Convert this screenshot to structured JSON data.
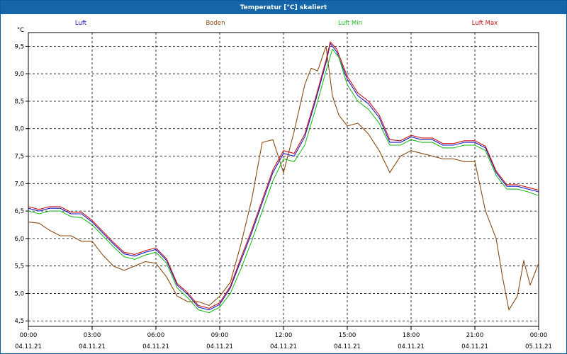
{
  "window": {
    "title": "Temperatur [°C] skaliert"
  },
  "chart_data": {
    "type": "line",
    "title": "Temperatur [°C] skaliert",
    "ylabel": "°C",
    "xlabel": "",
    "ylim": [
      4.4,
      9.75
    ],
    "xlim": [
      0,
      24
    ],
    "grid": true,
    "legend_position": "top",
    "y_ticks": [
      "9,5",
      "9,0",
      "8,5",
      "8,0",
      "7,5",
      "7,0",
      "6,5",
      "6,0",
      "5,5",
      "5,0",
      "4,5"
    ],
    "y_tick_values": [
      9.5,
      9.0,
      8.5,
      8.0,
      7.5,
      7.0,
      6.5,
      6.0,
      5.5,
      5.0,
      4.5
    ],
    "x_ticks": [
      {
        "time": "00:00",
        "date": "04.11.21",
        "value": 0
      },
      {
        "time": "03:00",
        "date": "04.11.21",
        "value": 3
      },
      {
        "time": "06:00",
        "date": "04.11.21",
        "value": 6
      },
      {
        "time": "09:00",
        "date": "04.11.21",
        "value": 9
      },
      {
        "time": "12:00",
        "date": "04.11.21",
        "value": 12
      },
      {
        "time": "15:00",
        "date": "04.11.21",
        "value": 15
      },
      {
        "time": "18:00",
        "date": "04.11.21",
        "value": 18
      },
      {
        "time": "21:00",
        "date": "04.11.21",
        "value": 21
      },
      {
        "time": "00:00",
        "date": "05.11.21",
        "value": 24
      }
    ],
    "series": [
      {
        "name": "Luft",
        "color": "#1a1acc",
        "x": [
          0,
          0.5,
          1,
          1.5,
          2,
          2.5,
          3,
          3.5,
          4,
          4.5,
          5,
          5.5,
          6,
          6.5,
          7,
          7.5,
          8,
          8.5,
          9,
          9.5,
          10,
          10.5,
          11,
          11.5,
          12,
          12.5,
          13,
          13.5,
          14,
          14.2,
          14.5,
          15,
          15.5,
          16,
          16.5,
          17,
          17.5,
          18,
          18.5,
          19,
          19.5,
          20,
          20.5,
          21,
          21.5,
          22,
          22.5,
          23,
          23.5,
          24
        ],
        "y": [
          6.55,
          6.5,
          6.55,
          6.55,
          6.45,
          6.45,
          6.3,
          6.1,
          5.9,
          5.72,
          5.68,
          5.75,
          5.8,
          5.6,
          5.15,
          4.98,
          4.75,
          4.7,
          4.8,
          5.1,
          5.6,
          6.1,
          6.65,
          7.2,
          7.55,
          7.5,
          7.85,
          8.5,
          9.2,
          9.55,
          9.4,
          8.9,
          8.6,
          8.45,
          8.2,
          7.75,
          7.75,
          7.85,
          7.8,
          7.8,
          7.7,
          7.7,
          7.75,
          7.75,
          7.65,
          7.2,
          6.95,
          6.95,
          6.9,
          6.85
        ]
      },
      {
        "name": "Boden",
        "color": "#8b4a12",
        "x": [
          0,
          0.5,
          1,
          1.5,
          2,
          2.5,
          3,
          3.5,
          4,
          4.5,
          5,
          5.5,
          6,
          6.5,
          7,
          7.5,
          8,
          8.5,
          9,
          9.5,
          10,
          10.5,
          11,
          11.5,
          12,
          12.5,
          13,
          13.3,
          13.6,
          14,
          14.3,
          14.6,
          15,
          15.5,
          16,
          16.5,
          17,
          17.5,
          18,
          18.5,
          19,
          19.5,
          20,
          20.5,
          21,
          21.5,
          22,
          22.3,
          22.6,
          23,
          23.3,
          23.6,
          24
        ],
        "y": [
          6.3,
          6.28,
          6.15,
          6.05,
          6.05,
          5.95,
          5.95,
          5.7,
          5.5,
          5.42,
          5.5,
          5.58,
          5.55,
          5.3,
          4.95,
          4.85,
          4.85,
          4.78,
          4.95,
          5.2,
          5.9,
          6.7,
          7.75,
          7.8,
          7.2,
          7.95,
          8.8,
          9.1,
          9.05,
          9.5,
          8.6,
          8.25,
          8.05,
          8.1,
          7.9,
          7.6,
          7.2,
          7.5,
          7.6,
          7.55,
          7.5,
          7.45,
          7.45,
          7.4,
          7.4,
          6.5,
          6.0,
          5.3,
          4.7,
          4.95,
          5.6,
          5.15,
          5.55
        ]
      },
      {
        "name": "Luft Min",
        "color": "#22bb22",
        "x": [
          0,
          0.5,
          1,
          1.5,
          2,
          2.5,
          3,
          3.5,
          4,
          4.5,
          5,
          5.5,
          6,
          6.5,
          7,
          7.5,
          8,
          8.5,
          9,
          9.5,
          10,
          10.5,
          11,
          11.5,
          12,
          12.5,
          13,
          13.5,
          14,
          14.3,
          14.6,
          15,
          15.5,
          16,
          16.5,
          17,
          17.5,
          18,
          18.5,
          19,
          19.5,
          20,
          20.5,
          21,
          21.5,
          22,
          22.5,
          23,
          23.5,
          24
        ],
        "y": [
          6.5,
          6.45,
          6.5,
          6.5,
          6.4,
          6.38,
          6.25,
          6.05,
          5.85,
          5.67,
          5.62,
          5.7,
          5.75,
          5.55,
          5.1,
          4.92,
          4.7,
          4.65,
          4.75,
          5.0,
          5.45,
          5.95,
          6.5,
          7.05,
          7.45,
          7.4,
          7.7,
          8.35,
          9.05,
          9.45,
          9.3,
          8.8,
          8.5,
          8.35,
          8.1,
          7.7,
          7.7,
          7.8,
          7.75,
          7.75,
          7.65,
          7.65,
          7.7,
          7.7,
          7.6,
          7.15,
          6.9,
          6.9,
          6.85,
          6.78
        ]
      },
      {
        "name": "Luft Max",
        "color": "#cc1111",
        "x": [
          0,
          0.5,
          1,
          1.5,
          2,
          2.5,
          3,
          3.5,
          4,
          4.5,
          5,
          5.5,
          6,
          6.5,
          7,
          7.5,
          8,
          8.5,
          9,
          9.5,
          10,
          10.5,
          11,
          11.5,
          12,
          12.5,
          13,
          13.5,
          14,
          14.2,
          14.5,
          15,
          15.5,
          16,
          16.5,
          17,
          17.5,
          18,
          18.5,
          19,
          19.5,
          20,
          20.5,
          21,
          21.5,
          22,
          22.5,
          23,
          23.5,
          24
        ],
        "y": [
          6.58,
          6.53,
          6.58,
          6.58,
          6.48,
          6.48,
          6.33,
          6.13,
          5.93,
          5.75,
          5.71,
          5.78,
          5.83,
          5.63,
          5.18,
          5.01,
          4.78,
          4.73,
          4.83,
          5.13,
          5.65,
          6.15,
          6.7,
          7.25,
          7.6,
          7.55,
          7.9,
          8.55,
          9.25,
          9.58,
          9.45,
          8.95,
          8.65,
          8.5,
          8.25,
          7.8,
          7.78,
          7.88,
          7.83,
          7.83,
          7.73,
          7.73,
          7.78,
          7.78,
          7.68,
          7.23,
          6.98,
          6.98,
          6.93,
          6.88
        ]
      }
    ]
  }
}
